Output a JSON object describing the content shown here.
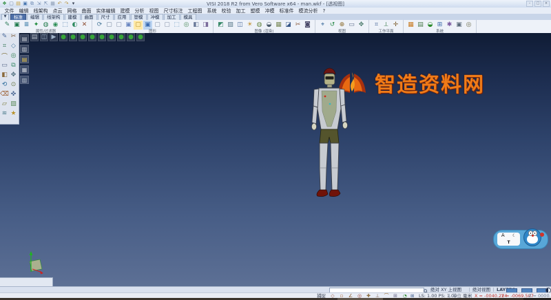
{
  "window": {
    "title": "VISI 2018 R2 from Vero Software x64 - man.wkf - [透视图]",
    "controls": [
      {
        "n": "minimize-button",
        "t": "–"
      },
      {
        "n": "maximize-button",
        "t": "□"
      },
      {
        "n": "close-button",
        "t": "×"
      }
    ]
  },
  "quick_access": [
    {
      "n": "visi-logo-icon",
      "g": "❖",
      "c": "#2f8f3f"
    },
    {
      "n": "new-file-icon",
      "g": "▢",
      "c": "#6f85a4"
    },
    {
      "n": "open-file-icon",
      "g": "▤",
      "c": "#c9a23a"
    },
    {
      "n": "save-icon",
      "g": "▣",
      "c": "#4a78b0"
    },
    {
      "n": "save-all-icon",
      "g": "⧉",
      "c": "#6f8cb4"
    },
    {
      "n": "import-icon",
      "g": "⇲",
      "c": "#7a92b4"
    },
    {
      "n": "export-icon",
      "g": "⇱",
      "c": "#7a92b4"
    },
    {
      "n": "print-icon",
      "g": "▦",
      "c": "#8b9cb4"
    },
    {
      "n": "undo-icon",
      "g": "↶",
      "c": "#b8923a"
    },
    {
      "n": "redo-icon",
      "g": "↷",
      "c": "#b8923a"
    },
    {
      "n": "qat-customize-icon",
      "g": "▾",
      "c": "#5a6activ"
    }
  ],
  "menubar": {
    "items": [
      "文件",
      "编辑",
      "线架构",
      "点云",
      "网格",
      "曲面",
      "实体编辑",
      "建模",
      "分析",
      "视图",
      "尺寸标注",
      "工程图",
      "系统",
      "校验",
      "加工",
      "塑模",
      "冲模",
      "标准件",
      "模流分析",
      "?"
    ]
  },
  "tabrow": {
    "dropdown_glyph": "▼",
    "tabs": [
      {
        "t": "标准",
        "n": "tab-standard",
        "active": true
      },
      {
        "t": "编辑",
        "n": "tab-edit"
      },
      {
        "t": "线架构",
        "n": "tab-wireframe"
      },
      {
        "t": "建模",
        "n": "tab-modeling"
      },
      {
        "t": "曲面",
        "n": "tab-surface"
      },
      {
        "t": "尺寸",
        "n": "tab-dimension"
      },
      {
        "t": "应用",
        "n": "tab-application"
      },
      {
        "t": "塑模",
        "n": "tab-mould"
      },
      {
        "t": "冲模",
        "n": "tab-die"
      },
      {
        "t": "加工",
        "n": "tab-machining"
      },
      {
        "t": "模具",
        "n": "tab-tooling"
      }
    ]
  },
  "ribbon": {
    "groups": [
      {
        "label": "属性/过滤器",
        "icons": [
          {
            "n": "attributes-icon",
            "g": "✎",
            "c": "#2e7d5b"
          },
          {
            "n": "color-filter-icon",
            "g": "▣",
            "c": "#1f7a4d"
          },
          {
            "n": "layer-filter-icon",
            "g": "≣",
            "c": "#2a6f9e"
          },
          {
            "n": "element-filter-icon",
            "g": "✦",
            "c": "#1d8a3a"
          },
          {
            "n": "mask-icon",
            "g": "◍",
            "c": "#267d4e"
          },
          {
            "n": "visibility-icon",
            "g": "◉",
            "c": "#2d8f57"
          },
          {
            "n": "selection-box-icon",
            "g": "⬚",
            "c": "#4a7aa8"
          },
          {
            "n": "invert-selection-icon",
            "g": "◐",
            "c": "#2e8a5f"
          },
          {
            "n": "clear-filter-icon",
            "g": "✕",
            "c": "#8a4a2e"
          }
        ]
      },
      {
        "label": "图形",
        "icons": [
          {
            "n": "redraw-icon",
            "g": "⟳",
            "c": "#4a7a9a"
          },
          {
            "n": "wireframe-display-icon",
            "g": "▢",
            "c": "#7a8aa0"
          },
          {
            "n": "hidden-line-icon",
            "g": "▢",
            "c": "#8a96ac"
          },
          {
            "n": "shaded-display-icon",
            "g": "▣",
            "c": "#6a86c0"
          },
          {
            "n": "zoom-window-icon",
            "g": "▢",
            "c": "#b89430",
            "bg": "#ffe9a8"
          },
          {
            "n": "zoom-all-icon",
            "g": "▣",
            "c": "#3a6ab0",
            "bg": "#bdd5f2"
          },
          {
            "n": "zoom-in-icon",
            "g": "▢",
            "c": "#8a96ac"
          },
          {
            "n": "zoom-out-icon",
            "g": "▢",
            "c": "#8a96ac"
          },
          {
            "n": "pan-icon",
            "g": "⬚",
            "c": "#6a9ac0"
          },
          {
            "n": "dynamic-rotate-icon",
            "g": "◎",
            "c": "#4a8a5a"
          },
          {
            "n": "previous-view-icon",
            "g": "◧",
            "c": "#6a7a9a"
          },
          {
            "n": "refresh-view-icon",
            "g": "◨",
            "c": "#7a6a9a"
          }
        ]
      },
      {
        "label": "图像 (渲染)",
        "icons": [
          {
            "n": "render-shaded-icon",
            "g": "◩",
            "c": "#3a8a6a"
          },
          {
            "n": "render-wireframe-icon",
            "g": "▨",
            "c": "#5a7a8a"
          },
          {
            "n": "render-quality-icon",
            "g": "◫",
            "c": "#4a6a9a"
          },
          {
            "n": "light-icon",
            "g": "☀",
            "c": "#c09030"
          },
          {
            "n": "material-icon",
            "g": "◍",
            "c": "#6a8a4a"
          },
          {
            "n": "shadow-icon",
            "g": "◒",
            "c": "#4a5a6a"
          },
          {
            "n": "texture-icon",
            "g": "▦",
            "c": "#7a8a5a"
          },
          {
            "n": "background-icon",
            "g": "◪",
            "c": "#3a5a8a"
          },
          {
            "n": "section-view-icon",
            "g": "✂",
            "c": "#8a5a3a"
          },
          {
            "n": "snapshot-icon",
            "g": "◙",
            "c": "#4a4a6a"
          }
        ]
      },
      {
        "label": "视图",
        "icons": [
          {
            "n": "measure-icon",
            "g": "⌖",
            "c": "#3a6a9a"
          },
          {
            "n": "rotate-view-icon",
            "g": "↺",
            "c": "#2a8a4a"
          },
          {
            "n": "center-view-icon",
            "g": "⊕",
            "c": "#8a6a2a"
          },
          {
            "n": "viewport-icon",
            "g": "▭",
            "c": "#5a6a8a"
          },
          {
            "n": "pan-view-icon",
            "g": "✥",
            "c": "#4a7a6a"
          }
        ]
      },
      {
        "label": "工作平面",
        "icons": [
          {
            "n": "workplane-xy-icon",
            "g": "⌗",
            "c": "#4a6a9a"
          },
          {
            "n": "workplane-align-icon",
            "g": "⟂",
            "c": "#3a7a4a"
          },
          {
            "n": "workplane-origin-icon",
            "g": "✛",
            "c": "#7a5a2a"
          }
        ]
      },
      {
        "label": "系统",
        "icons": [
          {
            "n": "palette-icon",
            "g": "▦",
            "c": "#c7791f"
          },
          {
            "n": "calculator-icon",
            "g": "▤",
            "c": "#4a7a4a"
          },
          {
            "n": "database-icon",
            "g": "◒",
            "c": "#2a8a2a"
          },
          {
            "n": "grid-settings-icon",
            "g": "⊞",
            "c": "#3a6aaa"
          },
          {
            "n": "tools-icon",
            "g": "✱",
            "c": "#7a5aa0"
          },
          {
            "n": "macro-icon",
            "g": "▣",
            "c": "#5a6a7a"
          },
          {
            "n": "help-icon",
            "g": "◎",
            "c": "#6a6a4a"
          }
        ]
      }
    ]
  },
  "left_toolbar": {
    "icons": [
      {
        "n": "select-tool-icon",
        "g": "✎",
        "c": "#4a6a9a"
      },
      {
        "n": "delete-tool-icon",
        "g": "✂",
        "c": "#7a5a3a"
      },
      {
        "n": "point-tool-icon",
        "g": "⌗",
        "c": "#3a7a5a"
      },
      {
        "n": "line-tool-icon",
        "g": "◇",
        "c": "#4a7aa0"
      },
      {
        "n": "arc-tool-icon",
        "g": "⌒",
        "c": "#7a6a30"
      },
      {
        "n": "circle-tool-icon",
        "g": "◎",
        "c": "#2a7a4a"
      },
      {
        "n": "rectangle-tool-icon",
        "g": "▭",
        "c": "#5a6a8a"
      },
      {
        "n": "offset-tool-icon",
        "g": "⧉",
        "c": "#3a8a6a"
      },
      {
        "n": "mirror-tool-icon",
        "g": "◧",
        "c": "#8a6a3a"
      },
      {
        "n": "move-tool-icon",
        "g": "✥",
        "c": "#4a6a7a"
      },
      {
        "n": "rotate-tool-icon",
        "g": "⟲",
        "c": "#2a6a9a"
      },
      {
        "n": "scale-tool-icon",
        "g": "⊙",
        "c": "#6a7a4a"
      },
      {
        "n": "trim-tool-icon",
        "g": "⌫",
        "c": "#9a5a2a"
      },
      {
        "n": "dimension-tool-icon",
        "g": "✜",
        "c": "#3a5a8a"
      },
      {
        "n": "text-tool-icon",
        "g": "▱",
        "c": "#7a7a3a"
      },
      {
        "n": "hatch-tool-icon",
        "g": "▨",
        "c": "#5a8a5a"
      },
      {
        "n": "measure-tool-icon",
        "g": "≋",
        "c": "#4a7a8a"
      },
      {
        "n": "star-tool-icon",
        "g": "★",
        "c": "#b8922a"
      }
    ]
  },
  "left_strip": {
    "icons": [
      {
        "n": "layer-panel-icon",
        "g": "▤",
        "c": "#c8cdd6"
      },
      {
        "n": "bodies-panel-icon",
        "g": "▥",
        "c": "#c8cdd6"
      },
      {
        "n": "wireframe-panel-icon",
        "g": "▤",
        "c": "#e0c050"
      },
      {
        "n": "workplane-panel-icon",
        "g": "▦",
        "c": "#c8cdd6"
      },
      {
        "n": "ucs-panel-icon",
        "g": "▥",
        "c": "#b8c0cc"
      }
    ]
  },
  "canvas_toolbar": {
    "icons": [
      {
        "n": "display-mode-icon",
        "g": "▤",
        "c": "#b8c0cc"
      },
      {
        "n": "shading-icon",
        "g": "◫",
        "c": "#9fb2c8"
      },
      {
        "n": "play-icon",
        "g": "▶",
        "c": "#9fb2c8"
      },
      {
        "n": "view-iso-icon",
        "g": "●",
        "c": "#37a437"
      },
      {
        "n": "view-top-icon",
        "g": "●",
        "c": "#37a437"
      },
      {
        "n": "view-front-icon",
        "g": "●",
        "c": "#37a437"
      },
      {
        "n": "view-right-icon",
        "g": "●",
        "c": "#37a437"
      },
      {
        "n": "view-left-icon",
        "g": "●",
        "c": "#37a437"
      },
      {
        "n": "view-back-icon",
        "g": "●",
        "c": "#37a437"
      },
      {
        "n": "view-bottom-icon",
        "g": "●",
        "c": "#37a437"
      },
      {
        "n": "view-axono-icon",
        "g": "●",
        "c": "#37a437"
      },
      {
        "n": "view-dynamic-icon",
        "g": "●",
        "c": "#37a437"
      }
    ]
  },
  "watermark": {
    "text": "智造资料网",
    "color": "#ef7b18"
  },
  "viewport": {
    "model": {
      "hair": "#6e1612",
      "face": "#b4b288",
      "visor": "#23231c",
      "neck": "#a9a98a",
      "body": "#c7cbd1",
      "chest": "#93a076",
      "shorts": "#54542c",
      "hand": "#d6d6c2",
      "shoe": "#701309",
      "outline": "#3c4048"
    }
  },
  "status1": {
    "view_abs": "绝对 XY 上视图",
    "view_ref": "绝对视图",
    "layer": "LAYER0"
  },
  "status2": {
    "snap_label": "捕捉",
    "snap_icons": [
      {
        "n": "snap-point-icon",
        "g": "◇",
        "c": "#a05a3a"
      },
      {
        "n": "snap-endpoint-icon",
        "g": "▫",
        "c": "#b06a3a"
      },
      {
        "n": "snap-midpoint-icon",
        "g": "∠",
        "c": "#8a5a2a"
      },
      {
        "n": "snap-center-icon",
        "g": "◎",
        "c": "#a04a3a"
      },
      {
        "n": "snap-intersection-icon",
        "g": "✚",
        "c": "#8a6a3a"
      },
      {
        "n": "snap-perpendicular-icon",
        "g": "⊥",
        "c": "#7a5a4a"
      },
      {
        "n": "snap-tangent-icon",
        "g": "⌒",
        "c": "#9a6a2a"
      },
      {
        "n": "snap-grid-icon",
        "g": "⊞",
        "c": "#6a6a8a"
      }
    ],
    "timer_glyph": "◔",
    "grid_glyph": "⊞",
    "scale": "LS: 1.00 PS: 1.00",
    "units_label": "单位",
    "units_value": "毫米",
    "coord_x": "X = -0040.224",
    "coord_y": "Y = -0069.507",
    "coord_z": "Z = 0000.000"
  },
  "dora_widget": {
    "letter": "A",
    "moon": "☾",
    "shirt": "T"
  }
}
